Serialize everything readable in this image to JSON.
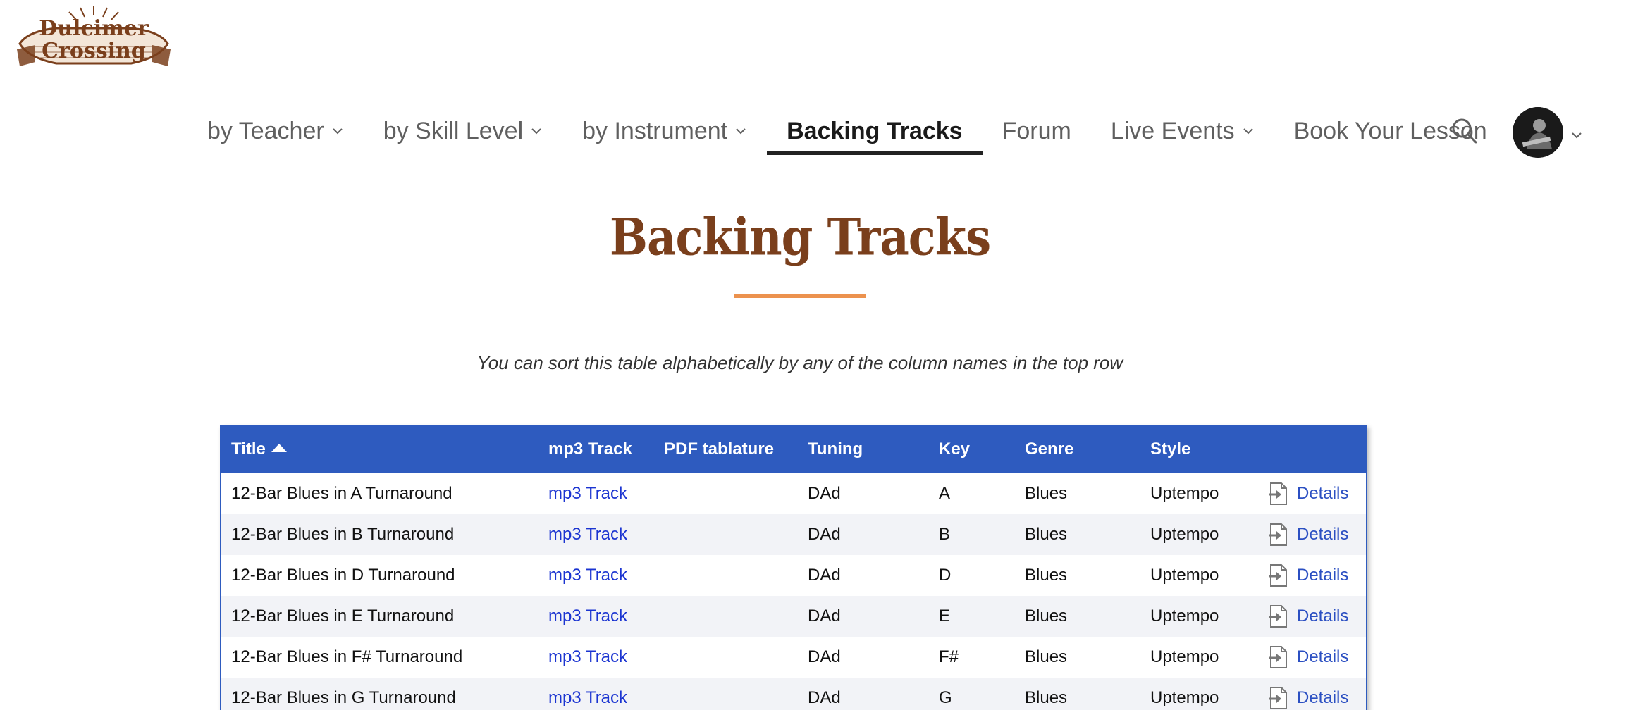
{
  "logo": {
    "line1": "Dulcimer",
    "line2": "Crossing",
    "icon": "dulcimer-logo"
  },
  "nav": {
    "items": [
      {
        "label": "by Teacher",
        "has_dropdown": true
      },
      {
        "label": "by Skill Level",
        "has_dropdown": true
      },
      {
        "label": "by Instrument",
        "has_dropdown": true
      },
      {
        "label": "Backing Tracks",
        "has_dropdown": false,
        "active": true
      },
      {
        "label": "Forum",
        "has_dropdown": false
      },
      {
        "label": "Live Events",
        "has_dropdown": true
      },
      {
        "label": "Book Your Lesson",
        "has_dropdown": false
      }
    ],
    "search_icon": "search-icon",
    "avatar_icon": "user-avatar"
  },
  "page": {
    "title": "Backing Tracks",
    "subtitle": "You can sort this table alphabetically by any of the column names in the top row"
  },
  "table": {
    "headers": {
      "title": "Title",
      "mp3": "mp3 Track",
      "pdf": "PDF tablature",
      "tuning": "Tuning",
      "key": "Key",
      "genre": "Genre",
      "style": "Style",
      "details": ""
    },
    "rows": [
      {
        "title": "12-Bar Blues in A Turnaround",
        "mp3": "mp3 Track",
        "pdf": "",
        "tuning": "DAd",
        "key": "A",
        "genre": "Blues",
        "style": "Uptempo",
        "details": "Details"
      },
      {
        "title": "12-Bar Blues in B Turnaround",
        "mp3": "mp3 Track",
        "pdf": "",
        "tuning": "DAd",
        "key": "B",
        "genre": "Blues",
        "style": "Uptempo",
        "details": "Details"
      },
      {
        "title": "12-Bar Blues in D Turnaround",
        "mp3": "mp3 Track",
        "pdf": "",
        "tuning": "DAd",
        "key": "D",
        "genre": "Blues",
        "style": "Uptempo",
        "details": "Details"
      },
      {
        "title": "12-Bar Blues in E Turnaround",
        "mp3": "mp3 Track",
        "pdf": "",
        "tuning": "DAd",
        "key": "E",
        "genre": "Blues",
        "style": "Uptempo",
        "details": "Details"
      },
      {
        "title": "12-Bar Blues in F# Turnaround",
        "mp3": "mp3 Track",
        "pdf": "",
        "tuning": "DAd",
        "key": "F#",
        "genre": "Blues",
        "style": "Uptempo",
        "details": "Details"
      },
      {
        "title": "12-Bar Blues in G Turnaround",
        "mp3": "mp3 Track",
        "pdf": "",
        "tuning": "DAd",
        "key": "G",
        "genre": "Blues",
        "style": "Uptempo",
        "details": "Details"
      }
    ]
  },
  "colors": {
    "header_blue": "#2e5bbf",
    "title_brown": "#7a3f1c",
    "accent_orange": "#ec924e",
    "link_blue": "#1b34d1"
  }
}
